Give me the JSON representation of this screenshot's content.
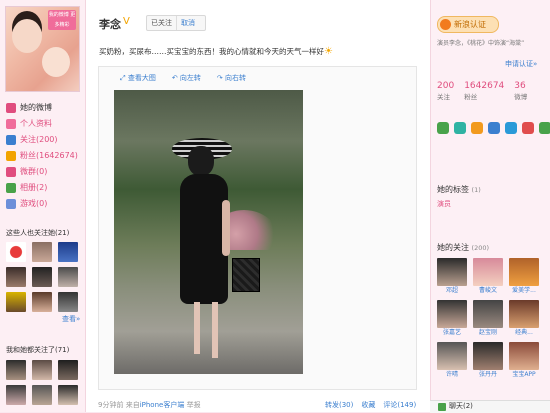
{
  "profile": {
    "name": "李念",
    "follow_state": "已关注",
    "unfollow_label": "取消",
    "avatar_tag": "我的微博 更多精彩"
  },
  "nav": {
    "items": [
      {
        "label": "她的微博",
        "color": "#e04d7e"
      },
      {
        "label": "个人资料",
        "color": "#f06c9a"
      },
      {
        "label": "关注(200)",
        "color": "#3b7fcf"
      },
      {
        "label": "粉丝(1642674)",
        "color": "#f2a300"
      },
      {
        "label": "微群(0)",
        "color": "#e04d7e"
      },
      {
        "label": "相册(2)",
        "color": "#49a24a"
      },
      {
        "label": "游戏(0)",
        "color": "#6c8fd9"
      }
    ]
  },
  "left_sections": {
    "also_follow_title": "这些人也关注她(21)",
    "more_label": "查看»",
    "common_title": "我和她都关注了(71)"
  },
  "post": {
    "text": "买奶粉，买尿布……买宝宝的东西！我的心情就和今天的天气一样好",
    "tools": [
      "查看大图",
      "向左转",
      "向右转"
    ],
    "time": "9分钟前",
    "source_prefix": "来自",
    "source": "iPhone客户端",
    "report": "举报",
    "actions": [
      "转发(30)",
      "收藏",
      "评论(149)"
    ]
  },
  "right": {
    "verify_label": "新浪认证",
    "intro": "演员李念，《桃花》中饰演“海棠”",
    "apply_label": "申请认证»",
    "stats": [
      {
        "value": "200",
        "label": "关注"
      },
      {
        "value": "1642674",
        "label": "粉丝"
      },
      {
        "value": "36",
        "label": "微博"
      }
    ],
    "tags_title": "她的标签",
    "tags_count": "(1)",
    "tag": "演员",
    "follow_title": "她的关注",
    "follow_count": "(200)",
    "follow_list": [
      "邓超",
      "曹峻文",
      "爱美学...",
      "张嘉艺",
      "赵宝刚",
      "经典...",
      "许晴",
      "张丹丹",
      "宝宝APP"
    ],
    "chat_label": "聊天(2)"
  },
  "colors": {
    "accent": "#e04d7e",
    "link": "#3b7fcf",
    "page_bg": "#fbe7ef"
  }
}
